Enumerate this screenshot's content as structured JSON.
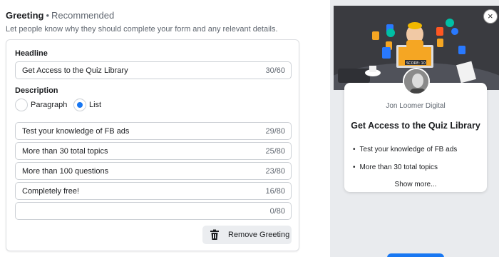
{
  "section": {
    "title": "Greeting",
    "badge": "Recommended",
    "description": "Let people know why they should complete your form and any relevant details."
  },
  "headline": {
    "label": "Headline",
    "value": "Get Access to the Quiz Library",
    "count": "30/60"
  },
  "description": {
    "label": "Description",
    "options": [
      "Paragraph",
      "List"
    ],
    "selected": "List",
    "items": [
      {
        "value": "Test your knowledge of FB ads",
        "count": "29/80"
      },
      {
        "value": "More than 30 total topics",
        "count": "25/80"
      },
      {
        "value": "More than 100 questions",
        "count": "23/80"
      },
      {
        "value": "Completely free!",
        "count": "16/80"
      },
      {
        "value": "",
        "count": "0/80"
      }
    ]
  },
  "remove_button": {
    "label": "Remove Greeting",
    "icon": "trash-icon"
  },
  "preview": {
    "hero_score": "SCORE: 10",
    "page_name": "Jon Loomer Digital",
    "headline": "Get Access to the Quiz Library",
    "bullets": [
      "Test your knowledge of FB ads",
      "More than 30 total topics"
    ],
    "show_more": "Show more...",
    "close_icon": "×"
  },
  "colors": {
    "accent": "#1877f2",
    "panel": "#e9ebee"
  }
}
